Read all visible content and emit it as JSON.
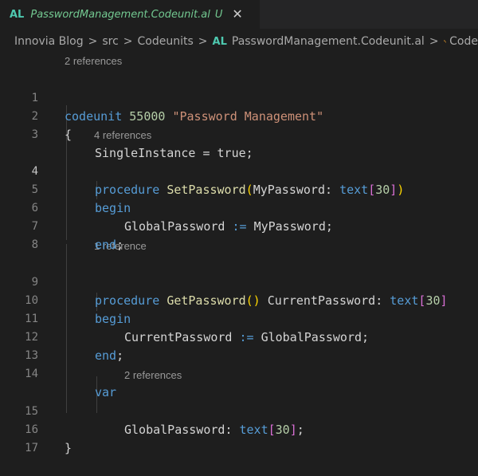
{
  "tab": {
    "badge": "AL",
    "title": "PasswordManagement.Codeunit.al",
    "status": "U",
    "close": "✕"
  },
  "breadcrumb": {
    "items": [
      "Innovia Blog",
      "src",
      "Codeunits"
    ],
    "file_badge": "AL",
    "file": "PasswordManagement.Codeunit.al",
    "symbol": "Code",
    "separator": ">"
  },
  "code_lens": {
    "codeunit": "2 references",
    "setpassword": "4 references",
    "getpassword": "1 reference",
    "globalpassword": "2 references"
  },
  "line_numbers": [
    "1",
    "2",
    "3",
    "4",
    "5",
    "6",
    "7",
    "8",
    "9",
    "10",
    "11",
    "12",
    "13",
    "14",
    "15",
    "16",
    "17"
  ],
  "code": {
    "l1_kw": "codeunit",
    "l1_num": "55000",
    "l1_str": "\"Password Management\"",
    "l2": "{",
    "l3_prop": "SingleInstance",
    "l3_eq": " = ",
    "l3_val": "true",
    "l3_end": ";",
    "l4_kw": "procedure",
    "l4_name": "SetPassword",
    "l4_open": "(",
    "l4_param": "MyPassword",
    "l4_colon": ": ",
    "l4_type": "text",
    "l4_b1": "[",
    "l4_len": "30",
    "l4_b2": "]",
    "l4_close": ")",
    "l5_kw": "begin",
    "l6_var": "GlobalPassword",
    "l6_op": " := ",
    "l6_val": "MyPassword",
    "l6_end": ";",
    "l7_kw": "end",
    "l7_end": ";",
    "l9_kw": "procedure",
    "l9_name": "GetPassword",
    "l9_parens": "()",
    "l9_ret": "CurrentPassword",
    "l9_colon": ": ",
    "l9_type": "text",
    "l9_b1": "[",
    "l9_len": "30",
    "l9_b2": "]",
    "l10_kw": "begin",
    "l11_var": "CurrentPassword",
    "l11_op": " := ",
    "l11_val": "GlobalPassword",
    "l11_end": ";",
    "l12_kw": "end",
    "l12_end": ";",
    "l14_kw": "var",
    "l15_var": "GlobalPassword",
    "l15_colon": ": ",
    "l15_type": "text",
    "l15_b1": "[",
    "l15_len": "30",
    "l15_b2": "]",
    "l15_end": ";",
    "l16": "}"
  },
  "colors": {
    "keyword": "#569cd6",
    "number": "#b5cea8",
    "string": "#ce9178",
    "function": "#dcdcaa",
    "variable": "#9cdcfe",
    "type": "#4ec9b0",
    "untracked": "#73c991"
  },
  "icons": {
    "tab_close": "close-icon",
    "breadcrumb_symbol": "symbol-codeunit-icon"
  }
}
